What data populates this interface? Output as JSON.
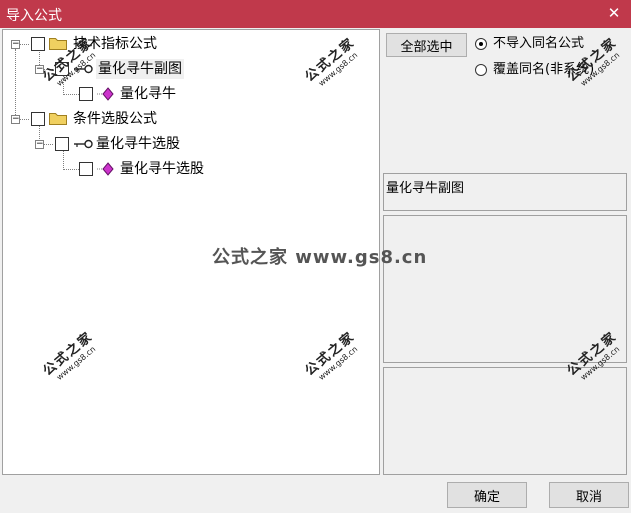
{
  "window": {
    "title": "导入公式",
    "close_glyph": "✕"
  },
  "tree": {
    "nodes": [
      {
        "label": "技术指标公式"
      },
      {
        "label": "量化寻牛副图"
      },
      {
        "label": "量化寻牛"
      },
      {
        "label": "条件选股公式"
      },
      {
        "label": "量化寻牛选股"
      },
      {
        "label": "量化寻牛选股"
      }
    ],
    "expander_glyph": "−"
  },
  "right": {
    "select_all_label": "全部选中",
    "radio_options": [
      {
        "label": "不导入同名公式",
        "selected": true
      },
      {
        "label": "覆盖同名(非系统)",
        "selected": false
      }
    ],
    "selected_name": "量化寻牛副图"
  },
  "buttons": {
    "ok_label": "确定",
    "cancel_label": "取消"
  },
  "watermark": {
    "text": "公式之家",
    "url": "www.gs8.cn",
    "center_text": "公式之家 www.gs8.cn"
  },
  "colors": {
    "titlebar": "#c0394b",
    "folder": "#f0d060",
    "gem": "#cc33cc"
  },
  "icons": [
    "folder-icon",
    "key-icon",
    "gem-icon",
    "close-icon"
  ]
}
